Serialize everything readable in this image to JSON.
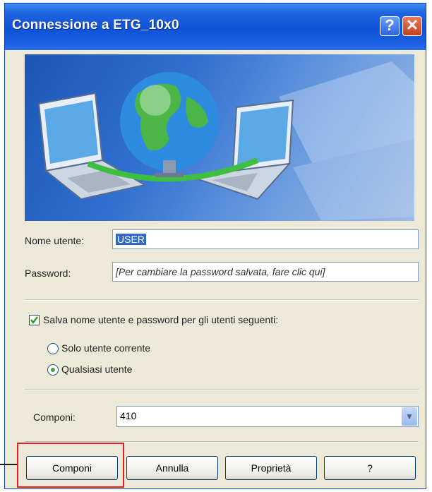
{
  "window": {
    "title": "Connessione a ETG_10x0",
    "help_label": "?",
    "close_label": "✕"
  },
  "form": {
    "username_label": "Nome utente:",
    "username_value": "USER",
    "password_label": "Password:",
    "password_hint": "[Per cambiare la password salvata, fare clic qui]",
    "save_label": "Salva nome utente e password per gli utenti seguenti:",
    "save_checked": true,
    "radio_current": "Solo utente corrente",
    "radio_any": "Qualsiasi utente",
    "selected_radio": "any",
    "dial_label": "Componi:",
    "dial_value": "410"
  },
  "buttons": {
    "dial": "Componi",
    "cancel": "Annulla",
    "properties": "Proprietà",
    "help": "?"
  },
  "colors": {
    "titlebar": "#0f52d6",
    "highlight": "#e02020",
    "selection": "#316ac5"
  }
}
